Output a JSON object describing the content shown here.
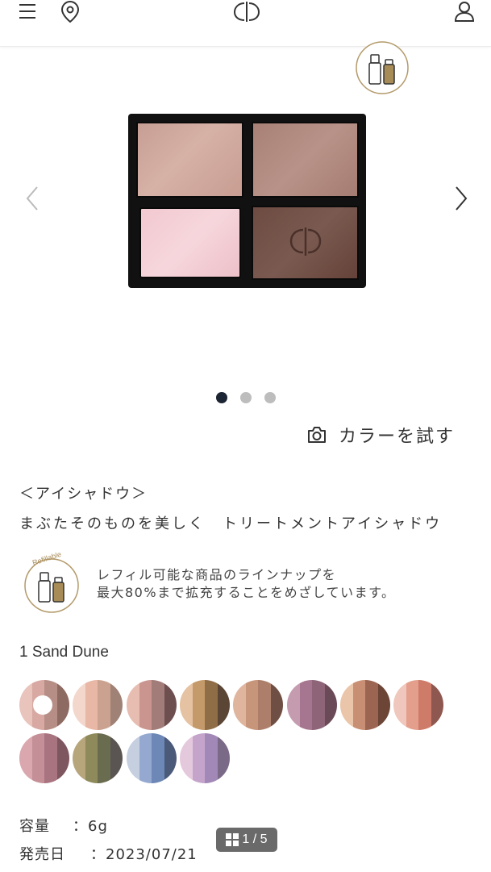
{
  "header": {
    "icons": [
      "menu-icon",
      "location-pin-icon",
      "brand-logo-icon",
      "user-icon"
    ]
  },
  "gallery": {
    "dots": [
      {
        "active": true
      },
      {
        "active": false
      },
      {
        "active": false
      }
    ],
    "try_color_label": "カラーを試す",
    "counter": "1 / 5"
  },
  "product": {
    "category": "＜アイシャドウ＞",
    "name": "まぶたそのものを美しく　トリートメントアイシャドウ"
  },
  "refill": {
    "badge_label": "Refillable",
    "line1": "レフィル可能な商品のラインナップを",
    "line2": "最大80%まで拡充することをめざしています。"
  },
  "shade": {
    "selected_name": "1 Sand Dune",
    "swatches": [
      {
        "stripes": [
          "#e9c4bd",
          "#d7a9a2",
          "#b78e86",
          "#8d6a62"
        ],
        "selected": true
      },
      {
        "stripes": [
          "#f3d7cc",
          "#e8b7a6",
          "#caa28f",
          "#a08175"
        ],
        "selected": false
      },
      {
        "stripes": [
          "#e7bcb1",
          "#c9958e",
          "#a17c79",
          "#6e4f4f"
        ],
        "selected": false
      },
      {
        "stripes": [
          "#e5c2a1",
          "#c59a6b",
          "#8f6d47",
          "#5b4636"
        ],
        "selected": false
      },
      {
        "stripes": [
          "#e0b59e",
          "#c79579",
          "#ad7f6b",
          "#6f4e43"
        ],
        "selected": false
      },
      {
        "stripes": [
          "#c59bb0",
          "#a6758f",
          "#8d6478",
          "#6a4a56"
        ],
        "selected": false
      },
      {
        "stripes": [
          "#eac5a9",
          "#c98f74",
          "#9c6552",
          "#6c4537"
        ],
        "selected": false
      },
      {
        "stripes": [
          "#f0c7bc",
          "#e49f8c",
          "#cf7b6a",
          "#8e5750"
        ],
        "selected": false
      },
      {
        "stripes": [
          "#d9a7ad",
          "#c48f97",
          "#a87480",
          "#7e5660"
        ],
        "selected": false
      },
      {
        "stripes": [
          "#b7a57c",
          "#8e8a5b",
          "#6a6c4f",
          "#5a5552"
        ],
        "selected": false
      },
      {
        "stripes": [
          "#c5cfe0",
          "#95a9d0",
          "#6d87b7",
          "#4a5a78"
        ],
        "selected": false
      },
      {
        "stripes": [
          "#e4c9dc",
          "#c4a4cb",
          "#a188b6",
          "#7a6a88"
        ],
        "selected": false
      }
    ]
  },
  "specs": {
    "capacity_label": "容量",
    "capacity_value": "：6g",
    "release_label": "発売日",
    "release_value": "：2023/07/21"
  }
}
